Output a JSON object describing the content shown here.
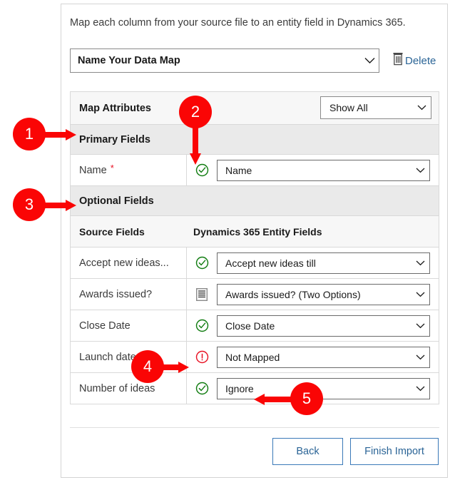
{
  "dialog": {
    "intro_text": "Map each column from your source file to an entity field in Dynamics 365.",
    "map_name": {
      "value": "Name Your Data Map",
      "placeholder": "Name Your Data Map"
    },
    "delete_label": "Delete",
    "delete_icon": "trash-icon",
    "chevron_icon": "chevron-down-icon"
  },
  "map_attributes": {
    "label": "Map Attributes",
    "filter_value": "Show All",
    "filter_options": [
      "Show All"
    ]
  },
  "sections": {
    "primary_fields_label": "Primary Fields",
    "optional_fields_label": "Optional Fields"
  },
  "columns": {
    "source": "Source Fields",
    "target": "Dynamics 365 Entity Fields"
  },
  "primary_rows": [
    {
      "source": "Name",
      "required": true,
      "required_marker": "*",
      "status_icon": "check-circle-icon",
      "status": "mapped",
      "target": "Name"
    }
  ],
  "optional_rows": [
    {
      "source": "Accept new ideas...",
      "required": false,
      "status_icon": "check-circle-icon",
      "status": "mapped",
      "target": "Accept new ideas till"
    },
    {
      "source": "Awards issued?",
      "required": false,
      "status_icon": "list-options-icon",
      "status": "options",
      "target": "Awards issued? (Two Options)"
    },
    {
      "source": "Close Date",
      "required": false,
      "status_icon": "check-circle-icon",
      "status": "mapped",
      "target": "Close Date"
    },
    {
      "source": "Launch date",
      "required": false,
      "status_icon": "error-circle-icon",
      "status": "not-mapped",
      "target": "Not Mapped"
    },
    {
      "source": "Number of ideas",
      "required": false,
      "status_icon": "check-circle-icon",
      "status": "mapped",
      "target": "Ignore"
    }
  ],
  "footer": {
    "back_label": "Back",
    "finish_label": "Finish Import"
  },
  "annotations": [
    {
      "number": "1",
      "points_to": "Primary Fields section header"
    },
    {
      "number": "2",
      "points_to": "Name row status check icon"
    },
    {
      "number": "3",
      "points_to": "Optional Fields section header"
    },
    {
      "number": "4",
      "points_to": "Launch date error icon"
    },
    {
      "number": "5",
      "points_to": "Ignore target value"
    }
  ],
  "colors": {
    "annotation_red": "#fa0505",
    "status_ok_green": "#107c10",
    "status_error_red": "#e81123",
    "link_blue": "#2a6496",
    "required_red": "#e81123"
  }
}
